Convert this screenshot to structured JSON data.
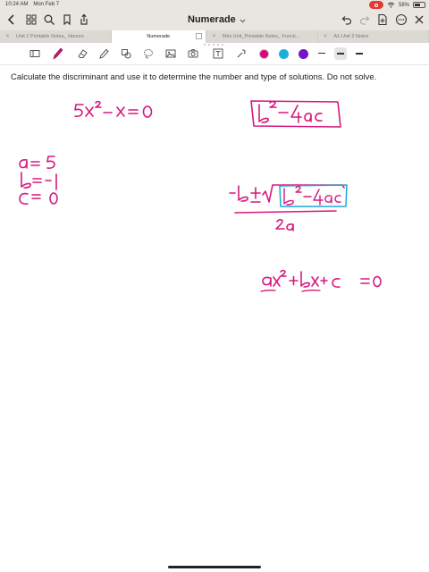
{
  "status": {
    "time": "10:24 AM",
    "date": "Mon Feb 7",
    "battery": "58%",
    "battery_level": 0.58
  },
  "nav": {
    "title": "Numerade",
    "title_chevron": "chevron-down-icon"
  },
  "tabs": [
    {
      "label": "Unit 1 Printable Notes_ Honors",
      "active": false
    },
    {
      "label": "Numerade",
      "active": true
    },
    {
      "label": "Mini Unit_Printable Notes_ Functi...",
      "active": false
    },
    {
      "label": "A1-Unit 2 Notes",
      "active": false
    }
  ],
  "toolbar": {
    "colors": [
      "#e0007f",
      "#1ab0d8",
      "#6f17c9"
    ],
    "selected_color": "#e0007f"
  },
  "page": {
    "prompt": "Calculate the discriminant and use it to determine the number and type of solutions. Do not solve."
  },
  "colors": {
    "ink_magenta": "#d6187f",
    "ink_cyan": "#19a8d8",
    "chrome": "#e9e6e1"
  }
}
